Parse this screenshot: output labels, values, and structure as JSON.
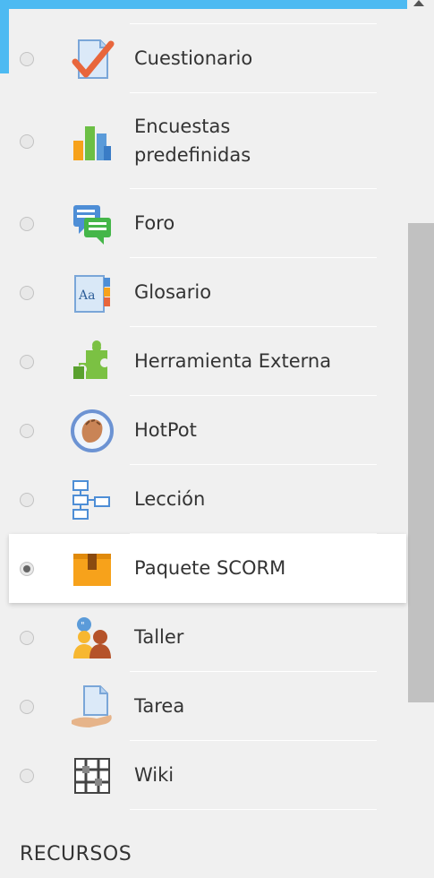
{
  "accent_color": "#4dbaf2",
  "activities": [
    {
      "label": "Cuestionario",
      "icon": "quiz-checkmark-icon",
      "selected": false
    },
    {
      "label": "Encuestas predefinidas",
      "icon": "survey-bar-chart-icon",
      "selected": false
    },
    {
      "label": "Foro",
      "icon": "forum-speech-bubbles-icon",
      "selected": false
    },
    {
      "label": "Glosario",
      "icon": "glossary-book-icon",
      "selected": false
    },
    {
      "label": "Herramienta Externa",
      "icon": "external-tool-puzzle-icon",
      "selected": false
    },
    {
      "label": "HotPot",
      "icon": "hotpot-hand-icon",
      "selected": false
    },
    {
      "label": "Lección",
      "icon": "lesson-flowchart-icon",
      "selected": false
    },
    {
      "label": "Paquete SCORM",
      "icon": "scorm-package-box-icon",
      "selected": true
    },
    {
      "label": "Taller",
      "icon": "workshop-people-icon",
      "selected": false
    },
    {
      "label": "Tarea",
      "icon": "assignment-hand-icon",
      "selected": false
    },
    {
      "label": "Wiki",
      "icon": "wiki-puzzle-icon",
      "selected": false
    }
  ],
  "section": {
    "title": "RECURSOS"
  }
}
